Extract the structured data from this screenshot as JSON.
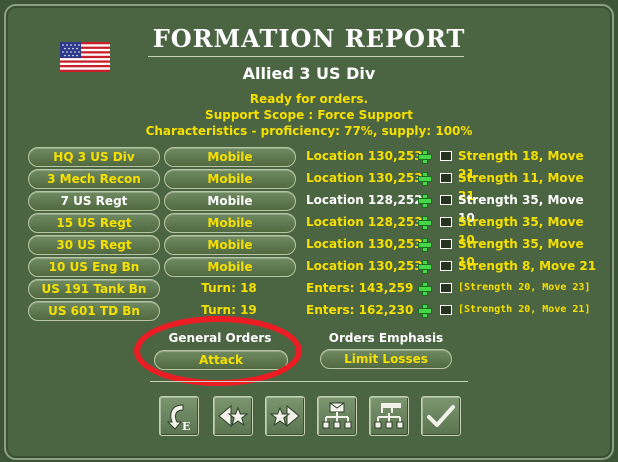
{
  "header": {
    "title": "FORMATION REPORT",
    "unit_name": "Allied 3 US Div",
    "status_lines": [
      "Ready for orders.",
      "Support Scope :  Force Support",
      "Characteristics - proficiency: 77%, supply: 100%"
    ]
  },
  "colors": {
    "accent_yellow": "#f5e000",
    "panel_green": "#4b6442",
    "highlight_red": "#ec1c24"
  },
  "units": [
    {
      "name": "HQ 3 US Div",
      "mode": "Mobile",
      "location": "Location 130,253",
      "stats": "Strength 18, Move 21",
      "icon": "hq-unit-icon",
      "bright": false,
      "mode_as_pill": true,
      "small_stats": false
    },
    {
      "name": "3 Mech Recon",
      "mode": "Mobile",
      "location": "Location 130,253",
      "stats": "Strength 11, Move 21",
      "icon": "recon-unit-icon",
      "bright": false,
      "mode_as_pill": true,
      "small_stats": false
    },
    {
      "name": "7 US Regt",
      "mode": "Mobile",
      "location": "Location 128,252",
      "stats": "Strength 35, Move 10",
      "icon": "infantry-unit-icon",
      "bright": true,
      "mode_as_pill": true,
      "small_stats": false
    },
    {
      "name": "15 US Regt",
      "mode": "Mobile",
      "location": "Location 128,253",
      "stats": "Strength 35, Move 10",
      "icon": "infantry-unit-icon",
      "bright": false,
      "mode_as_pill": true,
      "small_stats": false
    },
    {
      "name": "30 US Regt",
      "mode": "Mobile",
      "location": "Location 130,253",
      "stats": "Strength 35, Move 10",
      "icon": "infantry-unit-icon",
      "bright": false,
      "mode_as_pill": true,
      "small_stats": false
    },
    {
      "name": "10 US Eng Bn",
      "mode": "Mobile",
      "location": "Location 130,253",
      "stats": "Strength 8, Move 21",
      "icon": "engineer-unit-icon",
      "bright": false,
      "mode_as_pill": true,
      "small_stats": false
    },
    {
      "name": "US 191 Tank Bn",
      "mode": "Turn: 18",
      "location": "Enters: 143,259",
      "stats": "[Strength 20, Move 23]",
      "icon": "tank-unit-icon",
      "bright": false,
      "mode_as_pill": false,
      "small_stats": true
    },
    {
      "name": "US 601 TD Bn",
      "mode": "Turn: 19",
      "location": "Enters: 162,230",
      "stats": "[Strength 20, Move 21]",
      "icon": "tank-destroyer-unit-icon",
      "bright": false,
      "mode_as_pill": false,
      "small_stats": true
    }
  ],
  "orders": {
    "general_label": "General Orders",
    "general_value": "Attack",
    "emphasis_label": "Orders Emphasis",
    "emphasis_value": "Limit Losses"
  },
  "toolbar_icons": [
    "return-arrow-e-icon",
    "previous-formation-icon",
    "next-formation-icon",
    "message-hierarchy-icon",
    "flag-hierarchy-icon",
    "checkmark-icon"
  ]
}
